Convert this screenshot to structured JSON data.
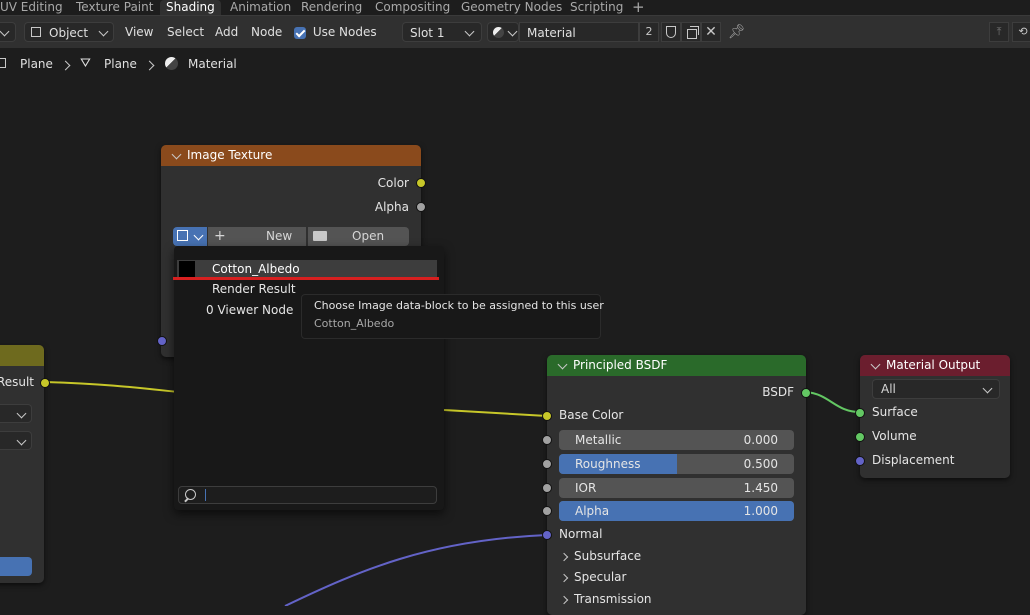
{
  "workspace_tabs": [
    "UV Editing",
    "Texture Paint",
    "Shading",
    "Animation",
    "Rendering",
    "Compositing",
    "Geometry Nodes",
    "Scripting",
    "+"
  ],
  "header": {
    "mode": "Object",
    "menus": [
      "View",
      "Select",
      "Add",
      "Node"
    ],
    "use_nodes_label": "Use Nodes",
    "slot": "Slot 1",
    "material_name": "Material",
    "user_count": "2"
  },
  "breadcrumb": {
    "object": "Plane",
    "mesh": "Plane",
    "material": "Material"
  },
  "image_texture_node": {
    "title": "Image Texture",
    "outputs": [
      "Color",
      "Alpha"
    ],
    "new_label": "New",
    "open_label": "Open"
  },
  "image_browser": {
    "items": [
      "Cotton_Albedo",
      "Render Result",
      "0 Viewer Node"
    ],
    "search_value": ""
  },
  "tooltip": {
    "description": "Choose Image data-block to be assigned to this user",
    "value": "Cotton_Albedo"
  },
  "partial_node": {
    "output": "Result"
  },
  "bsdf_node": {
    "title": "Principled BSDF",
    "output": "BSDF",
    "base_color_label": "Base Color",
    "fields": [
      {
        "name": "Metallic",
        "value": "0.000",
        "fill": 0.0
      },
      {
        "name": "Roughness",
        "value": "0.500",
        "fill": 0.5
      },
      {
        "name": "IOR",
        "value": "1.450",
        "fill": 0.0
      },
      {
        "name": "Alpha",
        "value": "1.000",
        "fill": 1.0
      }
    ],
    "normal_label": "Normal",
    "panels": [
      "Subsurface",
      "Specular",
      "Transmission"
    ]
  },
  "output_node": {
    "title": "Material Output",
    "target": "All",
    "inputs": [
      "Surface",
      "Volume",
      "Displacement"
    ]
  },
  "colors": {
    "texture_header": "#8a4a1c",
    "bsdf_header": "#2a6a2a",
    "output_header": "#6b1e2e",
    "partial_header": "#6e6a1e",
    "accent": "#4772b3",
    "highlight_line": "#d71f1f"
  }
}
